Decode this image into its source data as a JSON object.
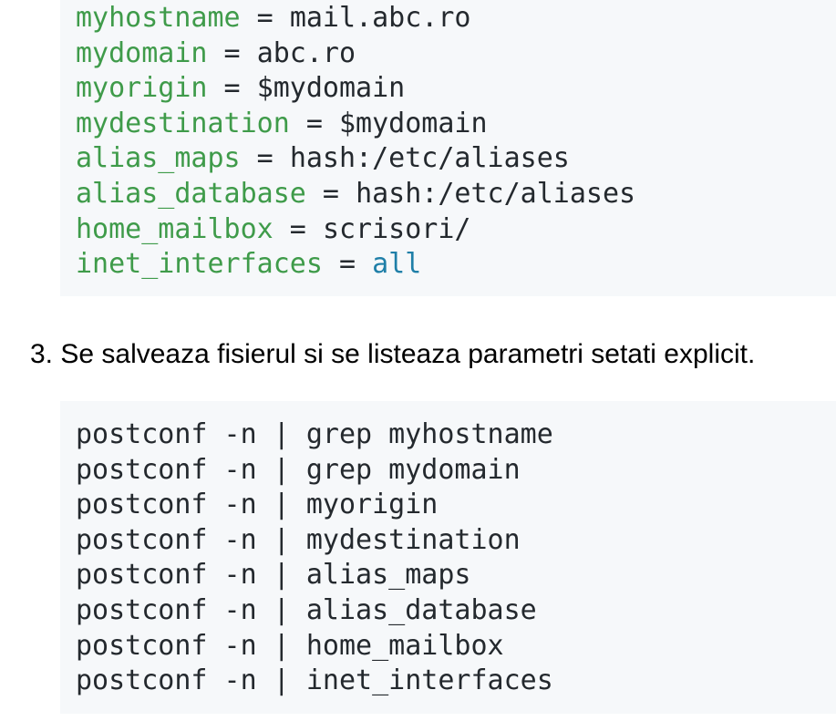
{
  "config_block": {
    "lines": [
      {
        "key": "myhostname",
        "op": " = ",
        "value": "mail.abc.ro",
        "keyword": false
      },
      {
        "key": "mydomain",
        "op": " = ",
        "value": "abc.ro",
        "keyword": false
      },
      {
        "key": "myorigin",
        "op": " = ",
        "value": "$mydomain",
        "keyword": false
      },
      {
        "key": "mydestination",
        "op": " = ",
        "value": "$mydomain",
        "keyword": false
      },
      {
        "key": "alias_maps",
        "op": " = ",
        "value": "hash:/etc/aliases",
        "keyword": false
      },
      {
        "key": "alias_database",
        "op": " = ",
        "value": "hash:/etc/aliases",
        "keyword": false
      },
      {
        "key": "home_mailbox",
        "op": " = ",
        "value": "scrisori/",
        "keyword": false
      },
      {
        "key": "inet_interfaces",
        "op": " = ",
        "value": "all",
        "keyword": true
      }
    ]
  },
  "step_text": "3. Se salveaza fisierul si se listeaza parametri setati explicit.",
  "commands_block": {
    "lines": [
      "postconf -n | grep myhostname",
      "postconf -n | grep mydomain",
      "postconf -n | myorigin",
      "postconf -n | mydestination",
      "postconf -n | alias_maps",
      "postconf -n | alias_database",
      "postconf -n | home_mailbox",
      "postconf -n | inet_interfaces"
    ]
  },
  "colors": {
    "code_background": "#f6f8fa",
    "key_green": "#3f9b4a",
    "keyword_blue": "#1f7fa8",
    "text_dark": "#24292e"
  }
}
